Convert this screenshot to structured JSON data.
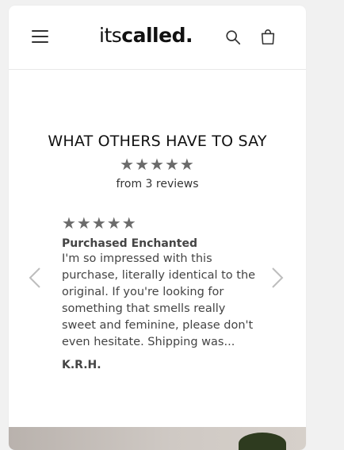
{
  "header": {
    "logo_prefix": "its",
    "logo_main": "called.",
    "menu_icon": "hamburger-menu-icon",
    "search_icon": "search-icon",
    "cart_icon": "shopping-bag-icon"
  },
  "reviews_section": {
    "title": "WHAT OTHERS HAVE TO SAY",
    "average_stars": "★★★★★",
    "rating": 5,
    "count_text": "from 3 reviews",
    "current_review": {
      "stars": "★★★★★",
      "rating": 5,
      "title": "Purchased Enchanted",
      "body": "I'm so impressed with this purchase, literally identical to the original. If you're looking for something that smells really sweet and feminine, please don't even hesitate. Shipping was...",
      "author": "K.R.H."
    },
    "prev_icon": "chevron-left-icon",
    "next_icon": "chevron-right-icon"
  },
  "colors": {
    "star": "#6b6b6b",
    "text": "#111111",
    "muted_text": "#444444",
    "background": "#ffffff",
    "page_background": "#f1f1f1"
  }
}
